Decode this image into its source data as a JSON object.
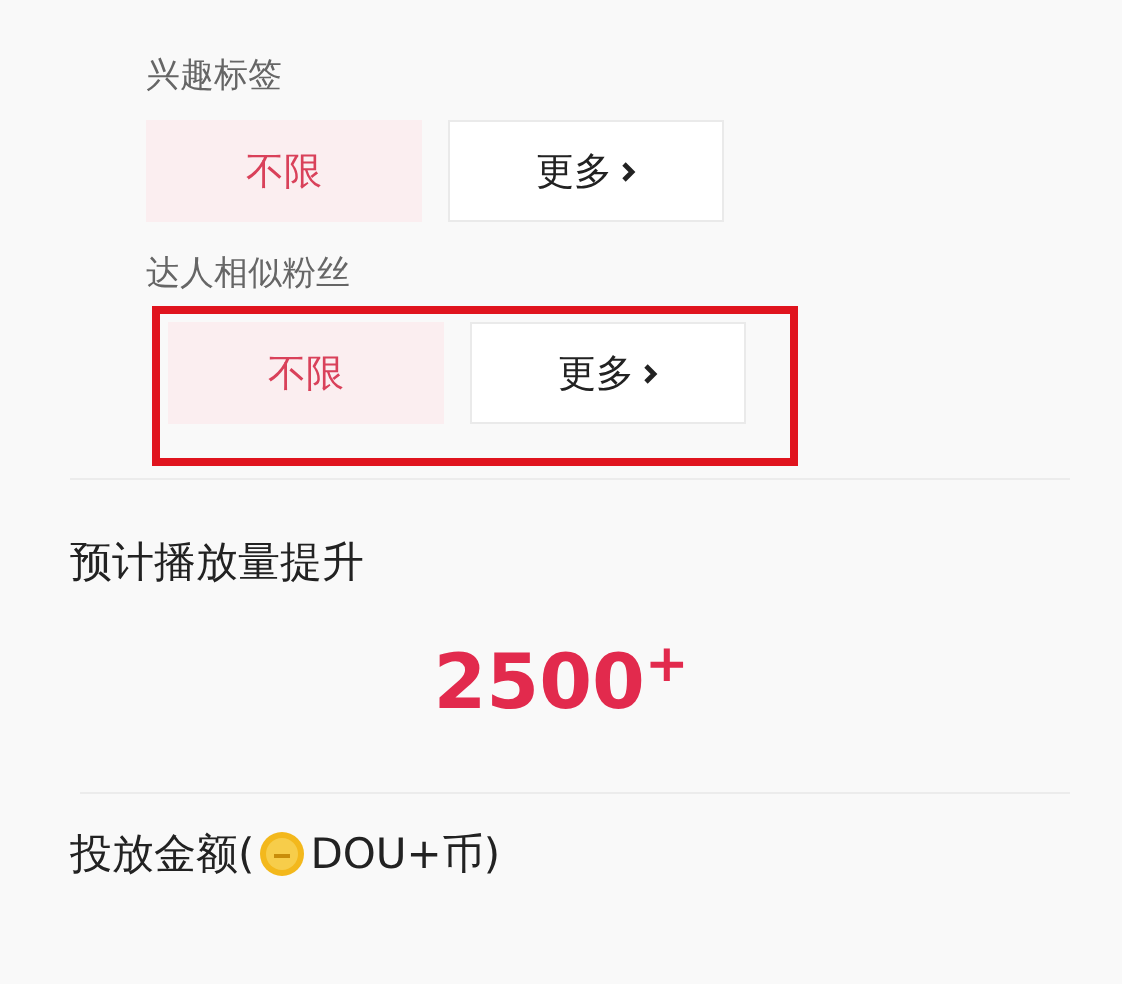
{
  "filter_groups": [
    {
      "label": "兴趣标签",
      "highlighted": false,
      "options": [
        {
          "label": "不限",
          "selected": true
        },
        {
          "label": "更多",
          "selected": false,
          "has_arrow": true
        }
      ]
    },
    {
      "label": "达人相似粉丝",
      "highlighted": true,
      "options": [
        {
          "label": "不限",
          "selected": true
        },
        {
          "label": "更多",
          "selected": false,
          "has_arrow": true
        }
      ]
    }
  ],
  "estimate": {
    "title": "预计播放量提升",
    "value": "2500$^{+}$"
  },
  "budget": {
    "label_before": "投放金额(",
    "label_after": "DOU+币)"
  }
}
